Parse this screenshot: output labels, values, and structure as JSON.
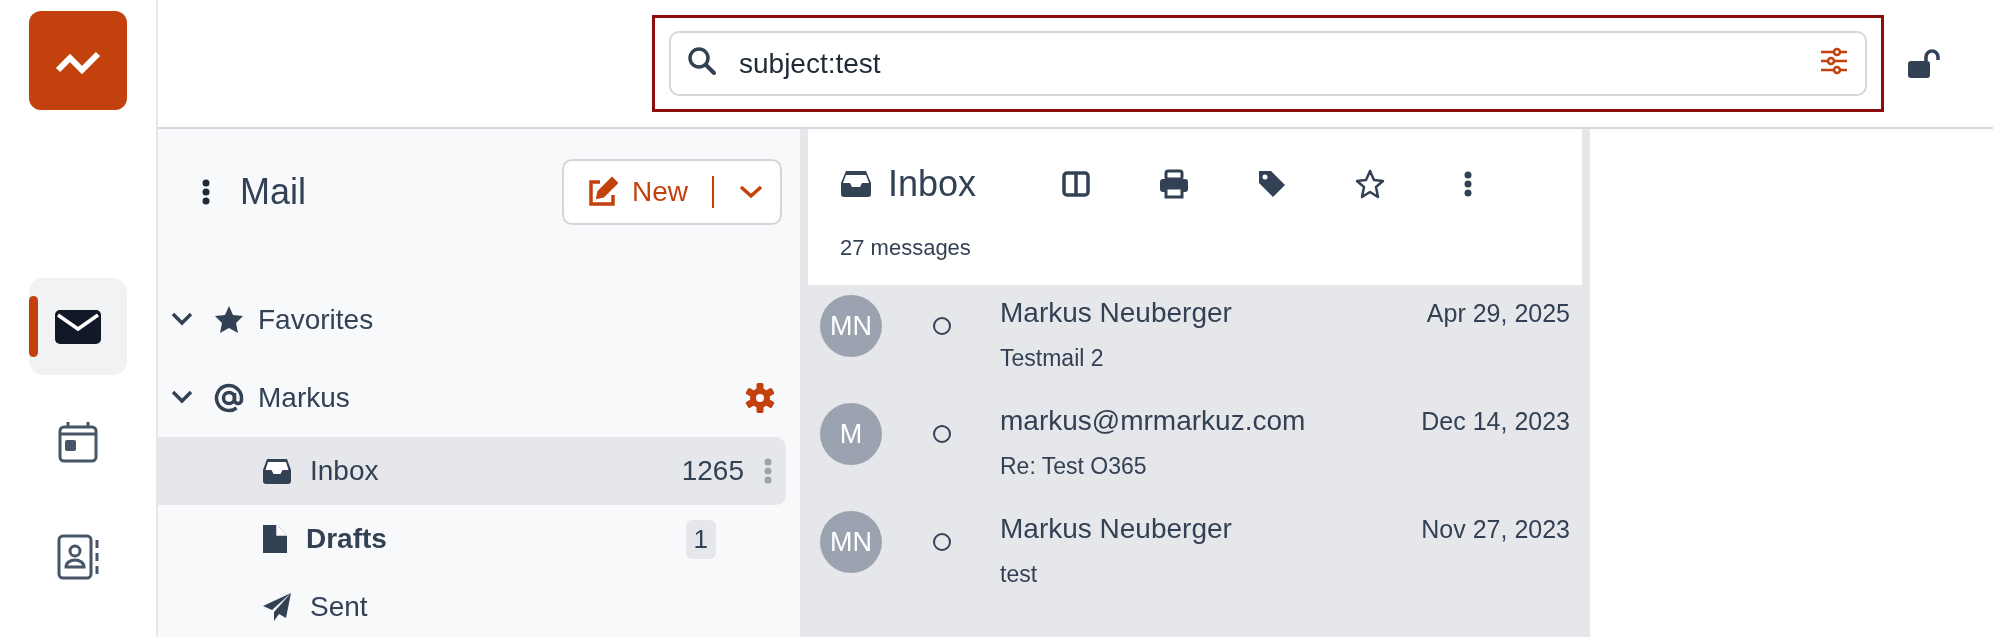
{
  "rail": {
    "items": [
      {
        "kind": "mail",
        "selected": true
      },
      {
        "kind": "calendar",
        "selected": false
      },
      {
        "kind": "contacts",
        "selected": false
      }
    ]
  },
  "search": {
    "value": "subject:test"
  },
  "folders": {
    "title": "Mail",
    "new_button": "New",
    "tree": [
      {
        "label": "Favorites",
        "kind": "favorites",
        "expanded": true
      },
      {
        "label": "Markus",
        "kind": "account",
        "expanded": true,
        "children": [
          {
            "label": "Inbox",
            "kind": "inbox",
            "count": "1265",
            "selected": true,
            "unread": false
          },
          {
            "label": "Drafts",
            "kind": "drafts",
            "count": "1",
            "selected": false,
            "unread": true
          },
          {
            "label": "Sent",
            "kind": "sent",
            "selected": false,
            "unread": false
          }
        ]
      }
    ]
  },
  "message_list": {
    "title": "Inbox",
    "count": "27 messages",
    "messages": [
      {
        "initials": "MN",
        "sender": "Markus Neuberger",
        "subject": "Testmail 2",
        "date": "Apr 29, 2025"
      },
      {
        "initials": "M",
        "sender": "markus@mrmarkuz.com",
        "subject": "Re: Test O365",
        "date": "Dec 14, 2023"
      },
      {
        "initials": "MN",
        "sender": "Markus Neuberger",
        "subject": "test",
        "date": "Nov 27, 2023"
      }
    ]
  }
}
